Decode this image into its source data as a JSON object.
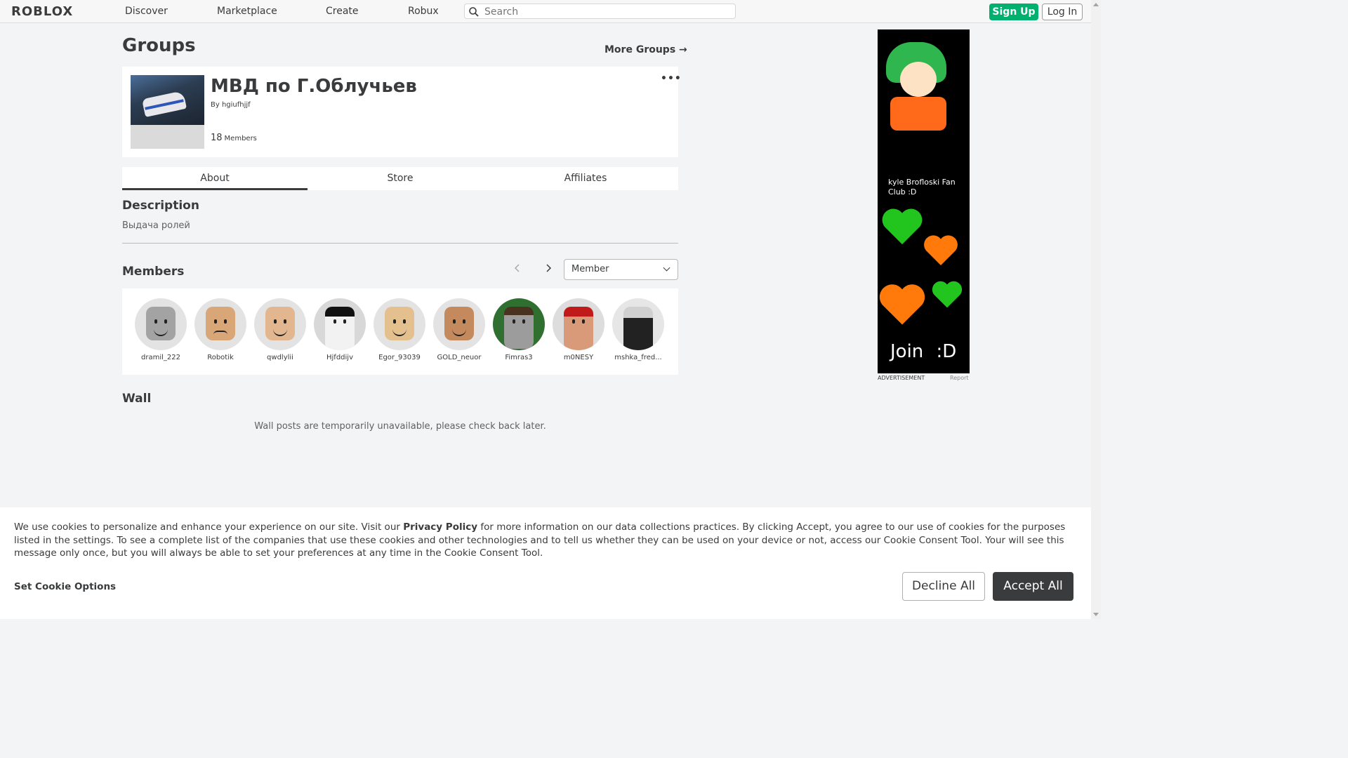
{
  "nav": {
    "logo": "ROBLOX",
    "links": [
      "Discover",
      "Marketplace",
      "Create",
      "Robux"
    ],
    "search_placeholder": "Search",
    "signup": "Sign Up",
    "login": "Log In"
  },
  "page": {
    "heading": "Groups",
    "more_groups": "More Groups →"
  },
  "group": {
    "name": "МВД по Г.Облучьев",
    "by_label": "By",
    "owner": "hgiufhjjf",
    "member_count": "18",
    "member_label": "Members",
    "more_icon": "more-dots-icon"
  },
  "tabs": [
    "About",
    "Store",
    "Affiliates"
  ],
  "about": {
    "description_heading": "Description",
    "description": "Выдача ролей"
  },
  "members": {
    "heading": "Members",
    "role_selected": "Member",
    "list": [
      "dramil_222",
      "Robotik",
      "qwdlylii",
      "Hjfddijv",
      "Egor_93039",
      "GOLD_neuor",
      "Fimras3",
      "m0NESY",
      "mshka_fred..."
    ]
  },
  "wall": {
    "heading": "Wall",
    "message": "Wall posts are temporarily unavailable, please check back later."
  },
  "ad": {
    "title": "kyle Brofloski Fan Club :D",
    "cta": "Join :D",
    "label": "ADVERTISEMENT",
    "report": "Report"
  },
  "cookie": {
    "text_before": "We use cookies to personalize and enhance your experience on our site. Visit our ",
    "policy": "Privacy Policy",
    "text_after": " for more information on our data collections practices. By clicking Accept, you agree to our use of cookies for the purposes listed in the settings. To see a complete list of the companies that use these cookies and other technologies and to tell us whether they can be used on your device or not, access our Cookie Consent Tool. Your will see this message only once, but you will always be able to set your preferences at any time in the Cookie Consent Tool.",
    "options": "Set Cookie Options",
    "decline": "Decline All",
    "accept": "Accept All"
  }
}
